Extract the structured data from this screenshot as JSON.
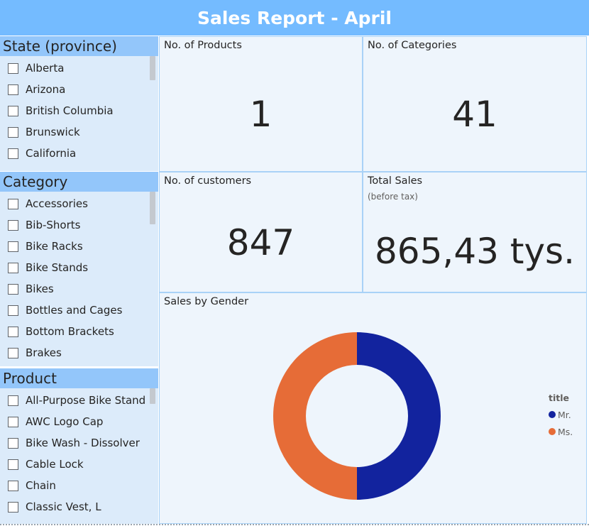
{
  "header": {
    "title": "Sales Report - April"
  },
  "slicers": {
    "state": {
      "title": "State (province)",
      "items": [
        "Alberta",
        "Arizona",
        "British Columbia",
        "Brunswick",
        "California"
      ]
    },
    "category": {
      "title": "Category",
      "items": [
        "Accessories",
        "Bib-Shorts",
        "Bike Racks",
        "Bike Stands",
        "Bikes",
        "Bottles and Cages",
        "Bottom Brackets",
        "Brakes"
      ]
    },
    "product": {
      "title": "Product",
      "items": [
        "All-Purpose Bike Stand",
        "AWC Logo Cap",
        "Bike Wash - Dissolver",
        "Cable Lock",
        "Chain",
        "Classic Vest, L"
      ]
    }
  },
  "cards": {
    "products": {
      "title": "No. of Products",
      "value": "1"
    },
    "categories": {
      "title": "No. of Categories",
      "value": "41"
    },
    "customers": {
      "title": "No. of customers",
      "value": "847"
    },
    "sales": {
      "title": "Total Sales",
      "subtitle": "(before tax)",
      "value": "865,43 tys."
    }
  },
  "chart_data": {
    "type": "pie",
    "title": "Sales by Gender",
    "legend_title": "title",
    "categories": [
      "Mr.",
      "Ms."
    ],
    "values": [
      50,
      50
    ],
    "colors": [
      "#12239E",
      "#E66C37"
    ],
    "donut": true,
    "legend_position": "right"
  },
  "colors": {
    "header": "#74BBFF",
    "slicer_bg": "#DCEBFA",
    "slicer_title_bg": "#93C6FA",
    "card_bg": "#EEF5FC",
    "card_border": "#A9D2F7"
  }
}
